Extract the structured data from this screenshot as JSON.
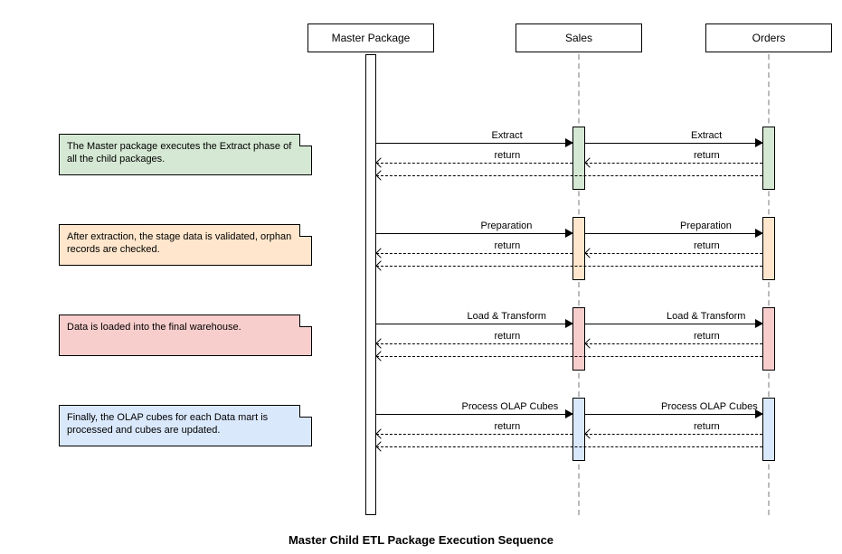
{
  "lifelines": {
    "master": "Master Package",
    "sales": "Sales",
    "orders": "Orders"
  },
  "notes": {
    "extract": "The Master package executes the Extract phase of all the child packages.",
    "prepare": "After extraction, the stage data is validated, orphan records are checked.",
    "load": "Data is loaded into the final warehouse.",
    "olap": "Finally, the OLAP cubes for each Data mart is processed and cubes are updated."
  },
  "messages": {
    "extract": "Extract",
    "prepare": "Preparation",
    "load": "Load & Transform",
    "olap": "Process OLAP Cubes",
    "ret": "return"
  },
  "caption": "Master Child ETL Package Execution Sequence",
  "chart_data": {
    "type": "sequence-diagram",
    "title": "Master Child ETL Package Execution Sequence",
    "participants": [
      "Master Package",
      "Sales",
      "Orders"
    ],
    "phases": [
      {
        "name": "Extract",
        "color": "green",
        "note": "The Master package executes the Extract phase of all the child packages.",
        "messages": [
          {
            "from": "Master Package",
            "to": "Sales",
            "label": "Extract",
            "kind": "call"
          },
          {
            "from": "Sales",
            "to": "Orders",
            "label": "Extract",
            "kind": "call"
          },
          {
            "from": "Sales",
            "to": "Master Package",
            "label": "return",
            "kind": "return"
          },
          {
            "from": "Orders",
            "to": "Sales",
            "label": "return",
            "kind": "return"
          },
          {
            "from": "Orders",
            "to": "Master Package",
            "label": "return",
            "kind": "return"
          }
        ]
      },
      {
        "name": "Preparation",
        "color": "orange",
        "note": "After extraction, the stage data is validated, orphan records are checked.",
        "messages": [
          {
            "from": "Master Package",
            "to": "Sales",
            "label": "Preparation",
            "kind": "call"
          },
          {
            "from": "Sales",
            "to": "Orders",
            "label": "Preparation",
            "kind": "call"
          },
          {
            "from": "Sales",
            "to": "Master Package",
            "label": "return",
            "kind": "return"
          },
          {
            "from": "Orders",
            "to": "Sales",
            "label": "return",
            "kind": "return"
          },
          {
            "from": "Orders",
            "to": "Master Package",
            "label": "return",
            "kind": "return"
          }
        ]
      },
      {
        "name": "Load & Transform",
        "color": "red",
        "note": "Data is loaded into the final warehouse.",
        "messages": [
          {
            "from": "Master Package",
            "to": "Sales",
            "label": "Load & Transform",
            "kind": "call"
          },
          {
            "from": "Sales",
            "to": "Orders",
            "label": "Load & Transform",
            "kind": "call"
          },
          {
            "from": "Sales",
            "to": "Master Package",
            "label": "return",
            "kind": "return"
          },
          {
            "from": "Orders",
            "to": "Sales",
            "label": "return",
            "kind": "return"
          },
          {
            "from": "Orders",
            "to": "Master Package",
            "label": "return",
            "kind": "return"
          }
        ]
      },
      {
        "name": "Process OLAP Cubes",
        "color": "blue",
        "note": "Finally, the OLAP cubes for each Data mart is processed and cubes are updated.",
        "messages": [
          {
            "from": "Master Package",
            "to": "Sales",
            "label": "Process OLAP Cubes",
            "kind": "call"
          },
          {
            "from": "Sales",
            "to": "Orders",
            "label": "Process OLAP Cubes",
            "kind": "call"
          },
          {
            "from": "Sales",
            "to": "Master Package",
            "label": "return",
            "kind": "return"
          },
          {
            "from": "Orders",
            "to": "Sales",
            "label": "return",
            "kind": "return"
          },
          {
            "from": "Orders",
            "to": "Master Package",
            "label": "return",
            "kind": "return"
          }
        ]
      }
    ]
  }
}
